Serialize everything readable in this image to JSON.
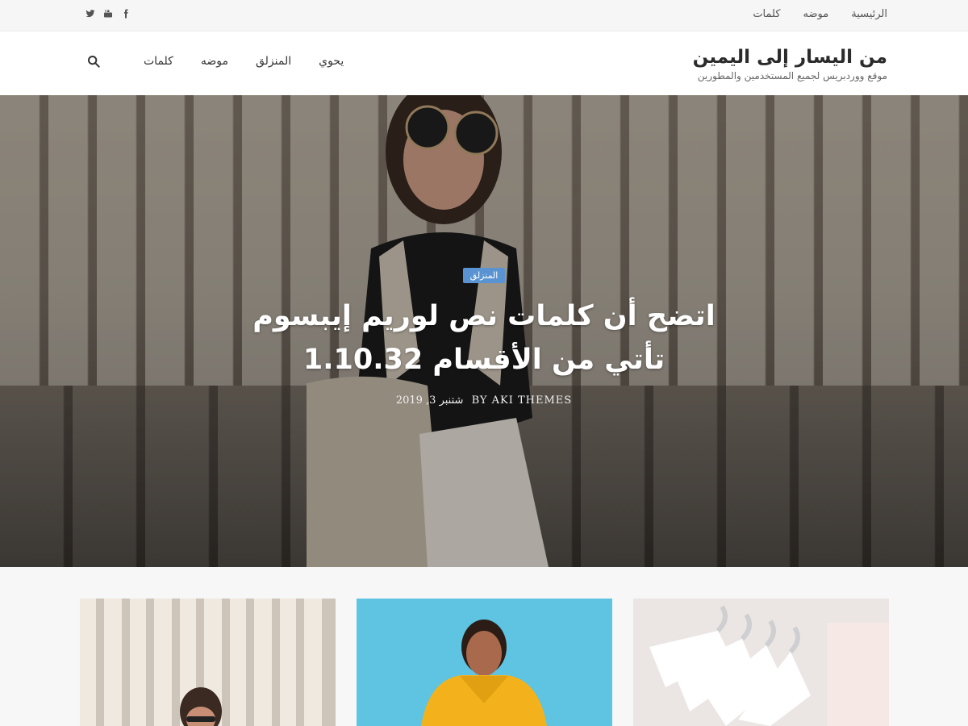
{
  "topbar": {
    "nav": [
      "الرئيسية",
      "موضه",
      "كلمات"
    ],
    "social": [
      "twitter-icon",
      "youtube-icon",
      "facebook-icon"
    ]
  },
  "header": {
    "site_title": "من اليسار إلى اليمين",
    "tagline": "موقع ووردبريس لجميع المستخدمين والمطورين",
    "nav": [
      "كلمات",
      "موضه",
      "المنزلق",
      "يحوي"
    ],
    "search_icon": "search-icon"
  },
  "hero": {
    "category": "المنزلق",
    "title": "اتضح أن كلمات نص لوريم إيبسوم تأتي من الأقسام 1.10.32",
    "author": "BY AKI THEMES",
    "date": "شتنبر 3, 2019"
  },
  "cards": [
    {
      "image": "woman-curtains-photo"
    },
    {
      "image": "woman-yellow-hoodie-photo"
    },
    {
      "image": "clothes-hangers-photo"
    }
  ],
  "colors": {
    "accent": "#5a93d1",
    "header_bg": "#ffffff",
    "topbar_bg": "#f6f6f6"
  }
}
